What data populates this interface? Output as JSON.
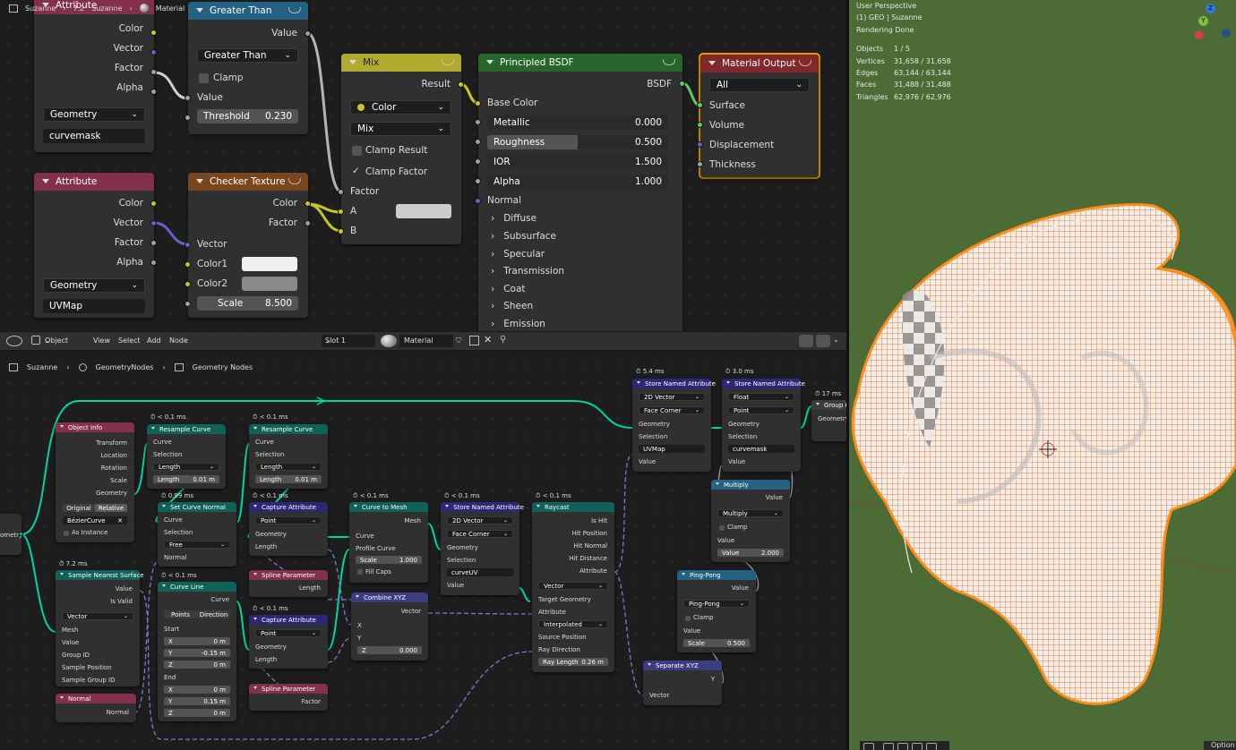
{
  "top_breadcrumb": {
    "object": "Suzanne",
    "modifier_icon": "7.2",
    "data": "Suzanne",
    "material": "Material"
  },
  "shader_nodes": {
    "attr1": {
      "title": "Attribute",
      "outputs": [
        "Color",
        "Vector",
        "Factor",
        "Alpha"
      ],
      "type": "Geometry",
      "name": "curvemask"
    },
    "greater": {
      "title": "Greater Than",
      "output": "Value",
      "op": "Greater Than",
      "clamp": "Clamp",
      "input": "Value",
      "threshold_label": "Threshold",
      "threshold": "0.230"
    },
    "mix": {
      "title": "Mix",
      "output": "Result",
      "data_type": "Color",
      "blend": "Mix",
      "clamp_result": "Clamp Result",
      "clamp_factor": "Clamp Factor",
      "inputs": [
        "Factor",
        "A",
        "B"
      ]
    },
    "bsdf": {
      "title": "Principled BSDF",
      "output": "BSDF",
      "base_color": "Base Color",
      "fields": [
        {
          "label": "Metallic",
          "value": "0.000"
        },
        {
          "label": "Roughness",
          "value": "0.500"
        },
        {
          "label": "IOR",
          "value": "1.500"
        },
        {
          "label": "Alpha",
          "value": "1.000"
        }
      ],
      "normal": "Normal",
      "panels": [
        "Diffuse",
        "Subsurface",
        "Specular",
        "Transmission",
        "Coat",
        "Sheen",
        "Emission"
      ]
    },
    "matout": {
      "title": "Material Output",
      "target": "All",
      "inputs": [
        "Surface",
        "Volume",
        "Displacement",
        "Thickness"
      ]
    },
    "attr2": {
      "title": "Attribute",
      "outputs": [
        "Color",
        "Vector",
        "Factor",
        "Alpha"
      ],
      "type": "Geometry",
      "name": "UVMap"
    },
    "checker": {
      "title": "Checker Texture",
      "outputs": [
        "Color",
        "Factor"
      ],
      "inputs": [
        "Vector",
        "Color1",
        "Color2"
      ],
      "scale_label": "Scale",
      "scale": "8.500"
    }
  },
  "header": {
    "mode": "Object",
    "menus": [
      "View",
      "Select",
      "Add",
      "Node"
    ],
    "slot": "Slot 1",
    "material": "Material"
  },
  "bottom_breadcrumb": {
    "object": "Suzanne",
    "modifier": "GeometryNodes",
    "tree": "Geometry Nodes"
  },
  "geo_nodes": {
    "frag_label": "ometry",
    "object_info": {
      "title": "Object Info",
      "outputs": [
        "Transform",
        "Location",
        "Rotation",
        "Scale",
        "Geometry"
      ],
      "tab_original": "Original",
      "tab_relative": "Relative",
      "object": "BézierCurve",
      "as_instance": "As Instance"
    },
    "resample1": {
      "timer": "< 0.1 ms",
      "title": "Resample Curve",
      "curve": "Curve",
      "selection": "Selection",
      "mode": "Length",
      "length_label": "Length",
      "length": "0.01 m"
    },
    "resample2": {
      "timer": "< 0.1 ms",
      "title": "Resample Curve",
      "curve": "Curve",
      "selection": "Selection",
      "mode": "Length",
      "length_label": "Length",
      "length": "0.01 m"
    },
    "set_normal": {
      "timer": "0.99 ms",
      "title": "Set Curve Normal",
      "curve": "Curve",
      "selection": "Selection",
      "mode": "Free",
      "normal": "Normal"
    },
    "capture1": {
      "timer": "< 0.1 ms",
      "title": "Capture Attribute",
      "domain": "Point",
      "geometry": "Geometry",
      "length": "Length"
    },
    "spline1": {
      "title": "Spline Parameter",
      "output": "Length"
    },
    "capture2": {
      "timer": "< 0.1 ms",
      "title": "Capture Attribute",
      "domain": "Point",
      "geometry": "Geometry",
      "length": "Length"
    },
    "spline2": {
      "title": "Spline Parameter",
      "output": "Factor"
    },
    "sample": {
      "timer": "7.2 ms",
      "title": "Sample Nearest Surface",
      "outputs": [
        "Value",
        "Is Valid"
      ],
      "type": "Vector",
      "inputs": [
        "Mesh",
        "Value",
        "Group ID",
        "Sample Position",
        "Sample Group ID"
      ]
    },
    "normal_node": {
      "title": "Normal",
      "output": "Normal"
    },
    "curve_line": {
      "timer": "< 0.1 ms",
      "title": "Curve Line",
      "output": "Curve",
      "tab_points": "Points",
      "tab_direction": "Direction",
      "start": "Start",
      "start_xyz": [
        {
          "k": "X",
          "v": "0 m"
        },
        {
          "k": "Y",
          "v": "-0.15 m"
        },
        {
          "k": "Z",
          "v": "0 m"
        }
      ],
      "end": "End",
      "end_xyz": [
        {
          "k": "X",
          "v": "0 m"
        },
        {
          "k": "Y",
          "v": "0.15 m"
        },
        {
          "k": "Z",
          "v": "0 m"
        }
      ]
    },
    "c2m": {
      "timer": "< 0.1 ms",
      "title": "Curve to Mesh",
      "output": "Mesh",
      "curve": "Curve",
      "profile": "Profile Curve",
      "scale_label": "Scale",
      "scale": "1.000",
      "fill_caps": "Fill Caps"
    },
    "combine": {
      "title": "Combine XYZ",
      "output": "Vector",
      "x": "X",
      "y": "Y",
      "z_label": "Z",
      "z": "0.000"
    },
    "store_uv": {
      "timer": "< 0.1 ms",
      "title": "Store Named Attribute",
      "type": "2D Vector",
      "domain": "Face Corner",
      "geometry": "Geometry",
      "selection": "Selection",
      "name": "curveUV",
      "value": "Value"
    },
    "raycast": {
      "timer": "< 0.1 ms",
      "title": "Raycast",
      "outputs": [
        "Is Hit",
        "Hit Position",
        "Hit Normal",
        "Hit Distance",
        "Attribute"
      ],
      "type": "Vector",
      "inputs": [
        "Target Geometry",
        "Attribute"
      ],
      "interp": "Interpolated",
      "pos": "Source Position",
      "dir": "Ray Direction",
      "len_label": "Ray Length",
      "len": "0.26 m"
    },
    "store2": {
      "timer": "5.4 ms",
      "title": "Store Named Attribute",
      "type": "2D Vector",
      "domain": "Face Corner",
      "geometry": "Geometry",
      "selection": "Selection",
      "name": "UVMap",
      "value": "Value"
    },
    "store3": {
      "timer": "3.0 ms",
      "title": "Store Named Attribute",
      "type": "Float",
      "domain": "Point",
      "geometry": "Geometry",
      "selection": "Selection",
      "name": "curvemask",
      "value": "Value"
    },
    "group_out": {
      "timer": "17 ms",
      "title": "Group O",
      "geometry": "Geometry"
    },
    "multiply": {
      "title": "Multiply",
      "output": "Value",
      "op": "Multiply",
      "clamp": "Clamp",
      "value": "Value",
      "value_label": "Value",
      "value_num": "2.000"
    },
    "pingpong": {
      "title": "Ping-Pong",
      "output": "Value",
      "op": "Ping-Pong",
      "clamp": "Clamp",
      "value": "Value",
      "scale_label": "Scale",
      "scale": "0.500"
    },
    "sepxyz": {
      "title": "Separate XYZ",
      "output": "Y",
      "input": "Vector"
    }
  },
  "viewport": {
    "line1": "User Perspective",
    "line2": "(1) GEO | Suzanne",
    "line3": "Rendering Done",
    "stats": [
      {
        "k": "Objects",
        "v": "1 / 5"
      },
      {
        "k": "Vertices",
        "v": "31,658 / 31,658"
      },
      {
        "k": "Edges",
        "v": "63,144 / 63,144"
      },
      {
        "k": "Faces",
        "v": "31,488 / 31,488"
      },
      {
        "k": "Triangles",
        "v": "62,976 / 62,976"
      }
    ],
    "axis_z": "Z",
    "axis_y": "Y",
    "options": "Option"
  }
}
